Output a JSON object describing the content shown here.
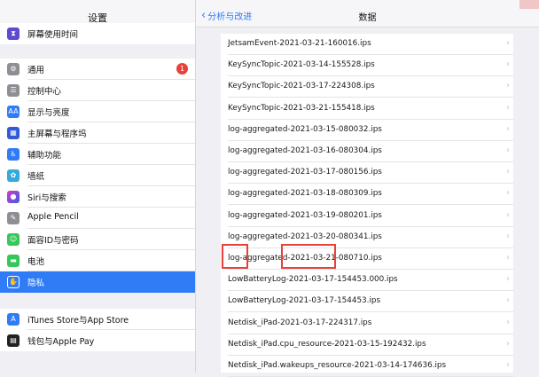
{
  "left": {
    "title": "设置",
    "items": [
      {
        "label": "屏幕使用时间",
        "icon": "hourglass-icon",
        "color": "#5b4bd1"
      },
      {
        "label": "通用",
        "icon": "gear-icon",
        "color": "#8e8e93",
        "badge": "1"
      },
      {
        "label": "控制中心",
        "icon": "toggles-icon",
        "color": "#8e8e93"
      },
      {
        "label": "显示与亮度",
        "icon": "text-size-icon",
        "color": "#2f7cf6"
      },
      {
        "label": "主屏幕与程序坞",
        "icon": "grid-icon",
        "color": "#2f5bd6"
      },
      {
        "label": "辅助功能",
        "icon": "accessibility-icon",
        "color": "#2f7cf6"
      },
      {
        "label": "墙纸",
        "icon": "flower-icon",
        "color": "#34aadc"
      },
      {
        "label": "Siri与搜索",
        "icon": "siri-icon",
        "color": "#333333"
      },
      {
        "label": "Apple Pencil",
        "icon": "pencil-icon",
        "color": "#8e8e93"
      },
      {
        "label": "面容ID与密码",
        "icon": "face-id-icon",
        "color": "#34c759"
      },
      {
        "label": "电池",
        "icon": "battery-icon",
        "color": "#34c759"
      },
      {
        "label": "隐私",
        "icon": "hand-icon",
        "color": "#2f7cf6",
        "selected": true
      },
      {
        "label": "iTunes Store与App Store",
        "icon": "app-store-icon",
        "color": "#2f7cf6"
      },
      {
        "label": "钱包与Apple Pay",
        "icon": "wallet-icon",
        "color": "#222222"
      }
    ]
  },
  "right": {
    "back_label": "分析与改进",
    "title": "数据",
    "files": [
      "JetsamEvent-2021-03-21-160016.ips",
      "KeySyncTopic-2021-03-14-155528.ips",
      "KeySyncTopic-2021-03-17-224308.ips",
      "KeySyncTopic-2021-03-21-155418.ips",
      "log-aggregated-2021-03-15-080032.ips",
      "log-aggregated-2021-03-16-080304.ips",
      "log-aggregated-2021-03-17-080156.ips",
      "log-aggregated-2021-03-18-080309.ips",
      "log-aggregated-2021-03-19-080201.ips",
      "log-aggregated-2021-03-20-080341.ips",
      "log-aggregated-2021-03-21-080710.ips",
      "LowBatteryLog-2021-03-17-154453.000.ips",
      "LowBatteryLog-2021-03-17-154453.ips",
      "Netdisk_iPad-2021-03-17-224317.ips",
      "Netdisk_iPad.cpu_resource-2021-03-15-192432.ips",
      "Netdisk_iPad.wakeups_resource-2021-03-14-174636.ips"
    ]
  },
  "colors": {
    "accent": "#2f7cf6",
    "highlight": "#e8413a"
  }
}
